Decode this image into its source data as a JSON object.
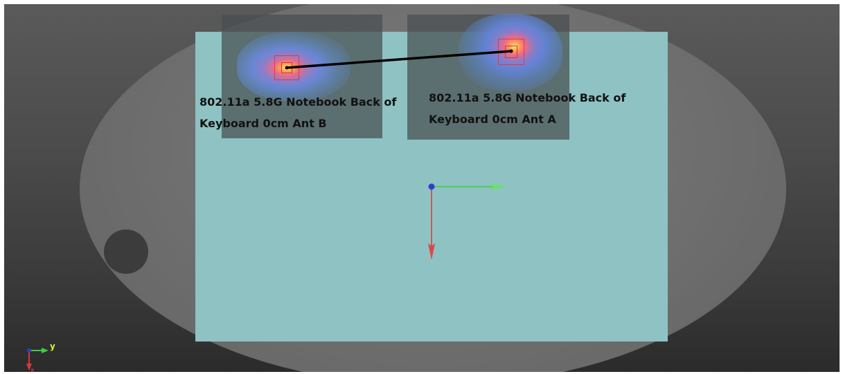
{
  "scene": {
    "labels": {
      "antenna_b": "802.11a 5.8G Notebook Back of Keyboard 0cm Ant B",
      "antenna_a": "802.11a 5.8G Notebook Back of Keyboard 0cm Ant A"
    },
    "triad": {
      "y_label": "y",
      "x_label": "x"
    }
  },
  "colors": {
    "background_top": "#5a5a5a",
    "background_bottom": "#2b2b2b",
    "phantom": "#6e6e6e",
    "device": "#8ec2c3",
    "scan_area": "#484e50",
    "marker": "#e23b3b",
    "connector": "#000000",
    "axis_x": "#d63a3a",
    "axis_y": "#3fcf3f",
    "origin": "#2c3fd0",
    "triad_label": "#d8f030"
  }
}
